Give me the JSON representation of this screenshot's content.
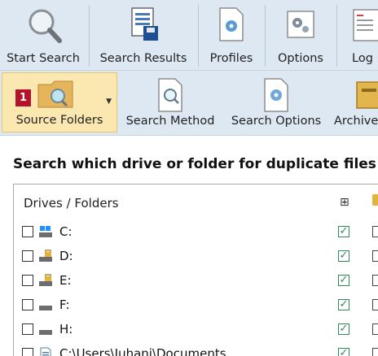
{
  "ribbon_top": {
    "buttons": [
      {
        "label": "Start Search",
        "icon": "magnifier-icon"
      },
      {
        "label": "Search Results",
        "icon": "results-save-icon"
      },
      {
        "label": "Profiles",
        "icon": "profiles-gear-icon"
      },
      {
        "label": "Options",
        "icon": "options-gear-icon"
      },
      {
        "label": "Log",
        "icon": "log-icon"
      }
    ]
  },
  "ribbon_second": {
    "buttons": [
      {
        "label": "Source Folders",
        "icon": "folder-search-icon",
        "badge": "1"
      },
      {
        "label": "Search Method",
        "icon": "document-search-icon"
      },
      {
        "label": "Search Options",
        "icon": "document-gear-icon"
      },
      {
        "label": "Archive",
        "icon": "archive-icon"
      }
    ]
  },
  "main": {
    "heading": "Search which drive or folder for duplicate files",
    "table": {
      "column_header": "Drives / Folders",
      "rows": [
        {
          "label": "C:",
          "icon": "windows-drive-icon",
          "subfolders": true
        },
        {
          "label": "D:",
          "icon": "locked-drive-icon",
          "subfolders": true
        },
        {
          "label": "E:",
          "icon": "locked-drive-icon",
          "subfolders": true
        },
        {
          "label": "F:",
          "icon": "drive-icon",
          "subfolders": true
        },
        {
          "label": "H:",
          "icon": "drive-icon",
          "subfolders": true
        },
        {
          "label": "C:\\Users\\Juhani\\Documents",
          "icon": "document-folder-icon",
          "subfolders": true
        }
      ]
    }
  },
  "colors": {
    "ribbon_bg": "#dde8f3",
    "active_bg": "#fbe7b0",
    "badge_bg": "#b3132b",
    "check_green": "#2e8b57"
  }
}
